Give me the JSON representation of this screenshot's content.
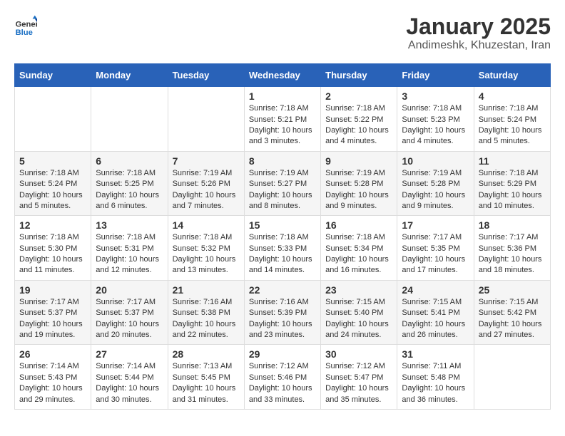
{
  "header": {
    "logo_general": "General",
    "logo_blue": "Blue",
    "title": "January 2025",
    "subtitle": "Andimeshk, Khuzestan, Iran"
  },
  "days_of_week": [
    "Sunday",
    "Monday",
    "Tuesday",
    "Wednesday",
    "Thursday",
    "Friday",
    "Saturday"
  ],
  "weeks": [
    [
      {
        "day": "",
        "content": ""
      },
      {
        "day": "",
        "content": ""
      },
      {
        "day": "",
        "content": ""
      },
      {
        "day": "1",
        "content": "Sunrise: 7:18 AM\nSunset: 5:21 PM\nDaylight: 10 hours\nand 3 minutes."
      },
      {
        "day": "2",
        "content": "Sunrise: 7:18 AM\nSunset: 5:22 PM\nDaylight: 10 hours\nand 4 minutes."
      },
      {
        "day": "3",
        "content": "Sunrise: 7:18 AM\nSunset: 5:23 PM\nDaylight: 10 hours\nand 4 minutes."
      },
      {
        "day": "4",
        "content": "Sunrise: 7:18 AM\nSunset: 5:24 PM\nDaylight: 10 hours\nand 5 minutes."
      }
    ],
    [
      {
        "day": "5",
        "content": "Sunrise: 7:18 AM\nSunset: 5:24 PM\nDaylight: 10 hours\nand 5 minutes."
      },
      {
        "day": "6",
        "content": "Sunrise: 7:18 AM\nSunset: 5:25 PM\nDaylight: 10 hours\nand 6 minutes."
      },
      {
        "day": "7",
        "content": "Sunrise: 7:19 AM\nSunset: 5:26 PM\nDaylight: 10 hours\nand 7 minutes."
      },
      {
        "day": "8",
        "content": "Sunrise: 7:19 AM\nSunset: 5:27 PM\nDaylight: 10 hours\nand 8 minutes."
      },
      {
        "day": "9",
        "content": "Sunrise: 7:19 AM\nSunset: 5:28 PM\nDaylight: 10 hours\nand 9 minutes."
      },
      {
        "day": "10",
        "content": "Sunrise: 7:19 AM\nSunset: 5:28 PM\nDaylight: 10 hours\nand 9 minutes."
      },
      {
        "day": "11",
        "content": "Sunrise: 7:18 AM\nSunset: 5:29 PM\nDaylight: 10 hours\nand 10 minutes."
      }
    ],
    [
      {
        "day": "12",
        "content": "Sunrise: 7:18 AM\nSunset: 5:30 PM\nDaylight: 10 hours\nand 11 minutes."
      },
      {
        "day": "13",
        "content": "Sunrise: 7:18 AM\nSunset: 5:31 PM\nDaylight: 10 hours\nand 12 minutes."
      },
      {
        "day": "14",
        "content": "Sunrise: 7:18 AM\nSunset: 5:32 PM\nDaylight: 10 hours\nand 13 minutes."
      },
      {
        "day": "15",
        "content": "Sunrise: 7:18 AM\nSunset: 5:33 PM\nDaylight: 10 hours\nand 14 minutes."
      },
      {
        "day": "16",
        "content": "Sunrise: 7:18 AM\nSunset: 5:34 PM\nDaylight: 10 hours\nand 16 minutes."
      },
      {
        "day": "17",
        "content": "Sunrise: 7:17 AM\nSunset: 5:35 PM\nDaylight: 10 hours\nand 17 minutes."
      },
      {
        "day": "18",
        "content": "Sunrise: 7:17 AM\nSunset: 5:36 PM\nDaylight: 10 hours\nand 18 minutes."
      }
    ],
    [
      {
        "day": "19",
        "content": "Sunrise: 7:17 AM\nSunset: 5:37 PM\nDaylight: 10 hours\nand 19 minutes."
      },
      {
        "day": "20",
        "content": "Sunrise: 7:17 AM\nSunset: 5:37 PM\nDaylight: 10 hours\nand 20 minutes."
      },
      {
        "day": "21",
        "content": "Sunrise: 7:16 AM\nSunset: 5:38 PM\nDaylight: 10 hours\nand 22 minutes."
      },
      {
        "day": "22",
        "content": "Sunrise: 7:16 AM\nSunset: 5:39 PM\nDaylight: 10 hours\nand 23 minutes."
      },
      {
        "day": "23",
        "content": "Sunrise: 7:15 AM\nSunset: 5:40 PM\nDaylight: 10 hours\nand 24 minutes."
      },
      {
        "day": "24",
        "content": "Sunrise: 7:15 AM\nSunset: 5:41 PM\nDaylight: 10 hours\nand 26 minutes."
      },
      {
        "day": "25",
        "content": "Sunrise: 7:15 AM\nSunset: 5:42 PM\nDaylight: 10 hours\nand 27 minutes."
      }
    ],
    [
      {
        "day": "26",
        "content": "Sunrise: 7:14 AM\nSunset: 5:43 PM\nDaylight: 10 hours\nand 29 minutes."
      },
      {
        "day": "27",
        "content": "Sunrise: 7:14 AM\nSunset: 5:44 PM\nDaylight: 10 hours\nand 30 minutes."
      },
      {
        "day": "28",
        "content": "Sunrise: 7:13 AM\nSunset: 5:45 PM\nDaylight: 10 hours\nand 31 minutes."
      },
      {
        "day": "29",
        "content": "Sunrise: 7:12 AM\nSunset: 5:46 PM\nDaylight: 10 hours\nand 33 minutes."
      },
      {
        "day": "30",
        "content": "Sunrise: 7:12 AM\nSunset: 5:47 PM\nDaylight: 10 hours\nand 35 minutes."
      },
      {
        "day": "31",
        "content": "Sunrise: 7:11 AM\nSunset: 5:48 PM\nDaylight: 10 hours\nand 36 minutes."
      },
      {
        "day": "",
        "content": ""
      }
    ]
  ]
}
